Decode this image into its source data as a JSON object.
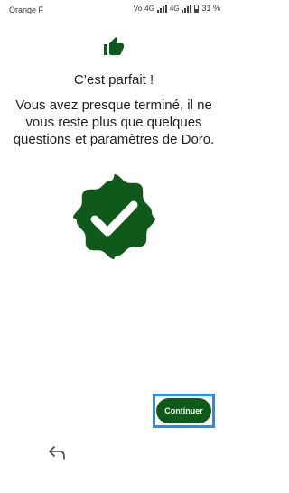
{
  "status_bar": {
    "carrier": "Orange F",
    "network_indicator": "Vo",
    "network_1": "4G",
    "network_2": "4G",
    "battery_percent": "31 %"
  },
  "screen": {
    "title": "C’est parfait !",
    "body_line_1": "Vous avez presque terminé, il ne",
    "body_line_2": "vous reste plus que quelques",
    "body_line_3": "questions et paramètres de Doro.",
    "continue_label": "Continuer"
  },
  "colors": {
    "accent_green": "#0f5a1b",
    "highlight_blue": "#1e90e8"
  },
  "icons": {
    "header_icon": "thumbs-up-icon",
    "badge_icon": "checkmark-badge-icon",
    "nav_icon": "back-arrow-icon"
  }
}
